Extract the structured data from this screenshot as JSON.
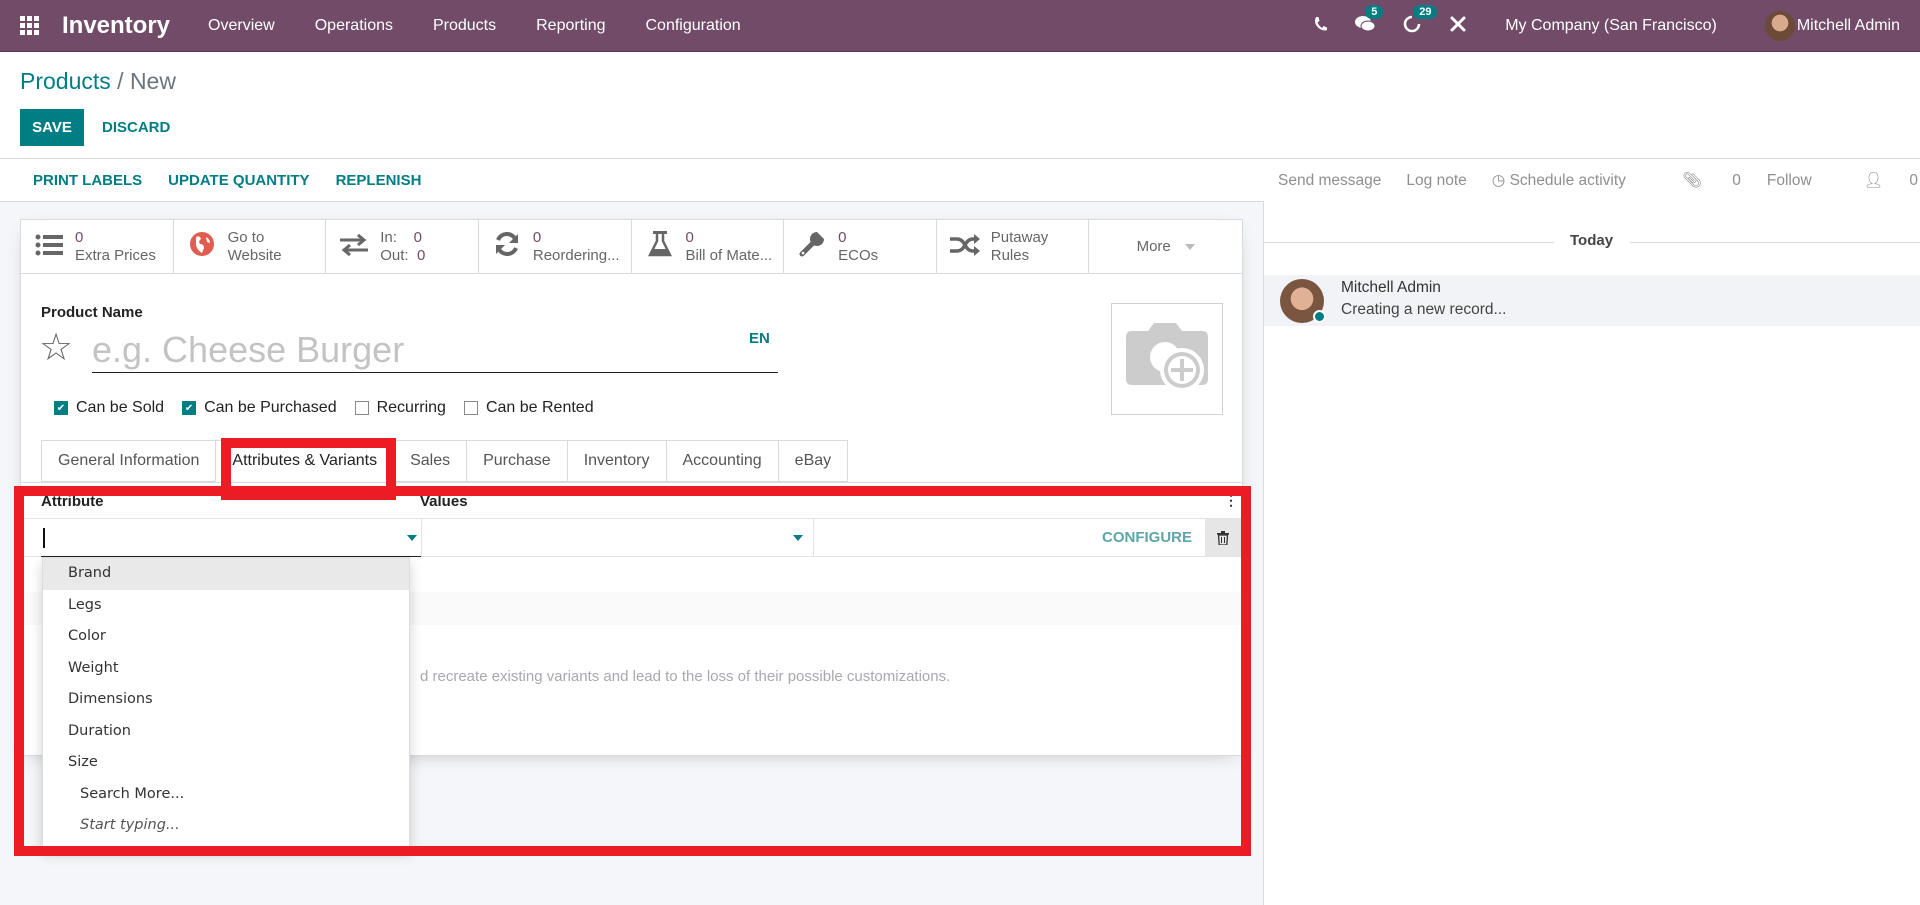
{
  "navbar": {
    "app_name": "Inventory",
    "menus": [
      "Overview",
      "Operations",
      "Products",
      "Reporting",
      "Configuration"
    ],
    "messages_count": "5",
    "activities_count": "29",
    "company": "My Company (San Francisco)",
    "user": "Mitchell Admin"
  },
  "breadcrumb": {
    "parent": "Products",
    "separator": "/",
    "current": "New"
  },
  "control": {
    "save_label": "SAVE",
    "discard_label": "DISCARD"
  },
  "actions": [
    "PRINT LABELS",
    "UPDATE QUANTITY",
    "REPLENISH"
  ],
  "stat_buttons": [
    {
      "icon": "list-icon",
      "value": "0",
      "label": "Extra Prices"
    },
    {
      "icon": "globe-icon",
      "line1": "Go to",
      "line2": "Website"
    },
    {
      "icon": "exchange-icon",
      "in_label": "In:",
      "in_value": "0",
      "out_label": "Out:",
      "out_value": "0"
    },
    {
      "icon": "refresh-icon",
      "value": "0",
      "label": "Reordering..."
    },
    {
      "icon": "flask-icon",
      "value": "0",
      "label": "Bill of Mate..."
    },
    {
      "icon": "wrench-icon",
      "value": "0",
      "label": "ECOs"
    },
    {
      "icon": "random-icon",
      "line1": "Putaway",
      "line2": "Rules"
    },
    {
      "label": "More"
    }
  ],
  "form": {
    "product_name_label": "Product Name",
    "product_name_placeholder": "e.g. Cheese Burger",
    "product_name_value": "",
    "language": "EN",
    "checkboxes": [
      {
        "label": "Can be Sold",
        "checked": true
      },
      {
        "label": "Can be Purchased",
        "checked": true
      },
      {
        "label": "Recurring",
        "checked": false
      },
      {
        "label": "Can be Rented",
        "checked": false
      }
    ],
    "tabs": [
      "General Information",
      "Attributes & Variants",
      "Sales",
      "Purchase",
      "Inventory",
      "Accounting",
      "eBay"
    ],
    "active_tab": "Attributes & Variants"
  },
  "attributes": {
    "col_attribute": "Attribute",
    "col_values": "Values",
    "configure_label": "CONFIGURE",
    "warning_text": "d recreate existing variants and lead to the loss of their possible customizations.",
    "dropdown_options": [
      "Brand",
      "Legs",
      "Color",
      "Weight",
      "Dimensions",
      "Duration",
      "Size"
    ],
    "search_more": "Search More...",
    "start_typing": "Start typing..."
  },
  "chatter": {
    "send_message": "Send message",
    "log_note": "Log note",
    "schedule_activity": "Schedule activity",
    "attachments_count": "0",
    "follow": "Follow",
    "followers_count": "0",
    "date_separator": "Today",
    "message": {
      "author": "Mitchell Admin",
      "body": "Creating a new record..."
    }
  },
  "highlight_color": "#ec1c24",
  "brand_color": "#714B67",
  "accent_color": "#017e84"
}
